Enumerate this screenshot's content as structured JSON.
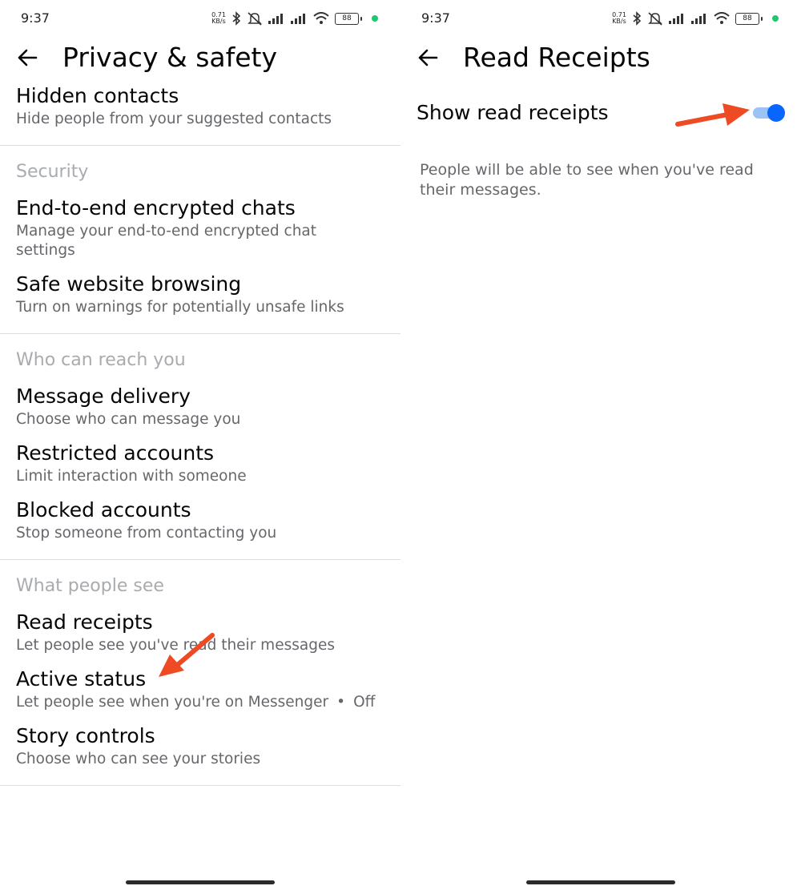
{
  "status_bar": {
    "time": "9:37",
    "speed_value": "0.71",
    "speed_unit": "KB/s",
    "battery": "88",
    "icons": [
      "bluetooth-icon",
      "mute-icon",
      "signal-icon",
      "signal-icon",
      "wifi-icon",
      "battery-icon"
    ]
  },
  "left": {
    "title": "Privacy & safety",
    "items_top": [
      {
        "title": "Hidden contacts",
        "subtitle": "Hide people from your suggested contacts"
      }
    ],
    "security": {
      "header": "Security",
      "items": [
        {
          "title": "End-to-end encrypted chats",
          "subtitle": "Manage your end-to-end encrypted chat settings"
        },
        {
          "title": "Safe website browsing",
          "subtitle": "Turn on warnings for potentially unsafe links"
        }
      ]
    },
    "reach": {
      "header": "Who can reach you",
      "items": [
        {
          "title": "Message delivery",
          "subtitle": "Choose who can message you"
        },
        {
          "title": "Restricted accounts",
          "subtitle": "Limit interaction with someone"
        },
        {
          "title": "Blocked accounts",
          "subtitle": "Stop someone from contacting you"
        }
      ]
    },
    "see": {
      "header": "What people see",
      "items": [
        {
          "title": "Read receipts",
          "subtitle": "Let people see you've read their messages"
        },
        {
          "title": "Active status",
          "subtitle": "Let people see when you're on Messenger",
          "separator": "•",
          "value": "Off"
        },
        {
          "title": "Story controls",
          "subtitle": "Choose who can see your stories"
        }
      ]
    }
  },
  "right": {
    "title": "Read Receipts",
    "toggle_label": "Show read receipts",
    "toggle_on": true,
    "description": "People will be able to see when you've read their messages."
  },
  "colors": {
    "accent": "#0866ff",
    "annotation": "#ee4a24",
    "secondary_text": "#65676b",
    "section_text": "#a8abaf"
  }
}
